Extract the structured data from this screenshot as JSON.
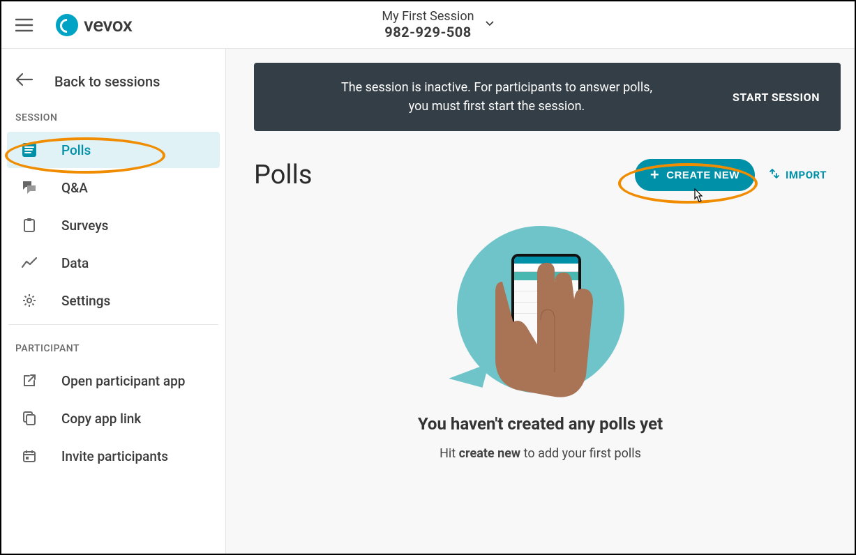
{
  "header": {
    "brand": "vevox",
    "session_name": "My First Session",
    "session_id": "982-929-508"
  },
  "sidebar": {
    "back_label": "Back to sessions",
    "section_session": "SESSION",
    "section_participant": "PARTICIPANT",
    "items_session": [
      {
        "label": "Polls",
        "active": true
      },
      {
        "label": "Q&A"
      },
      {
        "label": "Surveys"
      },
      {
        "label": "Data"
      },
      {
        "label": "Settings"
      }
    ],
    "items_participant": [
      {
        "label": "Open participant app"
      },
      {
        "label": "Copy app link"
      },
      {
        "label": "Invite participants"
      }
    ]
  },
  "banner": {
    "line1": "The session is inactive. For participants to answer polls,",
    "line2": "you must first start the session.",
    "action": "START SESSION"
  },
  "main": {
    "title": "Polls",
    "create_label": "CREATE NEW",
    "import_label": "IMPORT",
    "empty_heading": "You haven't created any polls yet",
    "empty_sub_prefix": "Hit ",
    "empty_sub_bold": "create new",
    "empty_sub_suffix": " to add your first polls"
  }
}
